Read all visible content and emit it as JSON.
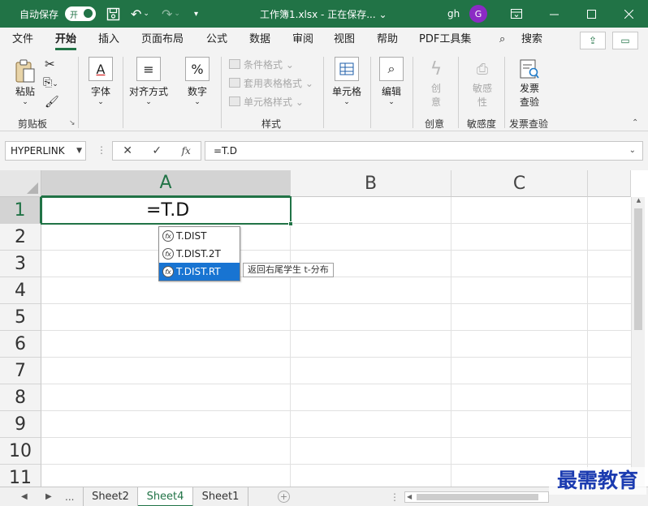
{
  "titlebar": {
    "autosave_label": "自动保存",
    "autosave_state": "开",
    "title": "工作簿1.xlsx - 正在保存... ⌄",
    "user": "gh",
    "avatar_initial": "G"
  },
  "tabs": [
    "文件",
    "开始",
    "插入",
    "页面布局",
    "公式",
    "数据",
    "审阅",
    "视图",
    "帮助",
    "PDF工具集"
  ],
  "search_label": "搜索",
  "ribbon": {
    "clipboard": {
      "paste": "粘贴",
      "group": "剪贴板"
    },
    "font": "字体",
    "align": "对齐方式",
    "number": "数字",
    "styles": {
      "items": [
        "条件格式 ⌄",
        "套用表格格式 ⌄",
        "单元格样式 ⌄"
      ],
      "group": "样式"
    },
    "cells": "单元格",
    "edit": "编辑",
    "creativity": {
      "btn_line1": "创",
      "btn_line2": "意",
      "group": "创意"
    },
    "sensitivity": {
      "btn_line1": "敏感",
      "btn_line2": "性",
      "group": "敏感度"
    },
    "invoice": {
      "btn_line1": "发票",
      "btn_line2": "查验",
      "group": "发票查验"
    },
    "number_icon": "%"
  },
  "formula_bar": {
    "name_box": "HYPERLINK",
    "formula": "=T.D",
    "fx": "fx"
  },
  "grid": {
    "columns": [
      "A",
      "B",
      "C"
    ],
    "rows": [
      "1",
      "2",
      "3",
      "4",
      "5",
      "6",
      "7",
      "8",
      "9",
      "10",
      "11"
    ],
    "active_cell_value": "=T.D"
  },
  "autocomplete": {
    "items": [
      "T.DIST",
      "T.DIST.2T",
      "T.DIST.RT"
    ],
    "selected_index": 2,
    "tooltip": "返回右尾学生 t-分布"
  },
  "sheets": {
    "ellipsis": "...",
    "tabs": [
      "Sheet2",
      "Sheet4",
      "Sheet1"
    ],
    "active": "Sheet4"
  },
  "watermark": "最需教育",
  "colors": {
    "accent": "#217346",
    "selection": "#1874d2",
    "avatar": "#8b2bc4"
  }
}
